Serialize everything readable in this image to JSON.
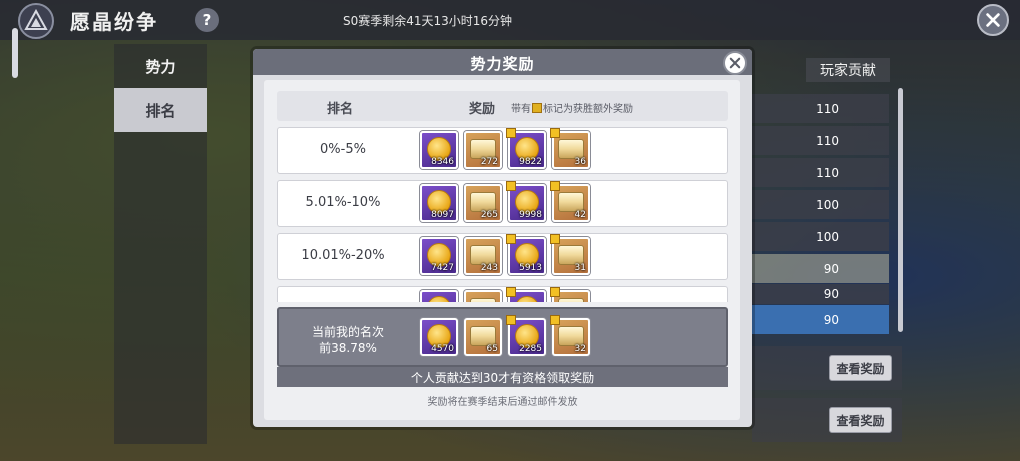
{
  "app": {
    "title": "愿晶纷争",
    "help_icon": "question-mark-icon",
    "season_remaining": "S0赛季剩余41天13小时16分钟",
    "close_icon": "close-icon"
  },
  "sidebar": {
    "tabs": [
      {
        "label": "势力"
      },
      {
        "label": "排名",
        "selected": true
      }
    ]
  },
  "background_list": {
    "header": "玩家贡献",
    "values": [
      "110",
      "110",
      "110",
      "100",
      "100",
      "90",
      "90",
      "90"
    ],
    "view_button_label": "查看奖励"
  },
  "dialog": {
    "title": "势力奖励",
    "col_rank": "排名",
    "col_reward": "奖励",
    "note_prefix": "带有",
    "note_suffix": "标记为获胜额外奖励",
    "rows": [
      {
        "label": "0%-5%",
        "items": [
          {
            "kind": "coin",
            "count": "8346"
          },
          {
            "kind": "chest",
            "count": "272"
          },
          {
            "kind": "coin",
            "count": "9822",
            "bonus": true
          },
          {
            "kind": "chest",
            "count": "36",
            "bonus": true
          }
        ]
      },
      {
        "label": "5.01%-10%",
        "items": [
          {
            "kind": "coin",
            "count": "8097"
          },
          {
            "kind": "chest",
            "count": "265"
          },
          {
            "kind": "coin",
            "count": "9998",
            "bonus": true
          },
          {
            "kind": "chest",
            "count": "42",
            "bonus": true
          }
        ]
      },
      {
        "label": "10.01%-20%",
        "items": [
          {
            "kind": "coin",
            "count": "7427"
          },
          {
            "kind": "chest",
            "count": "243"
          },
          {
            "kind": "coin",
            "count": "5913",
            "bonus": true
          },
          {
            "kind": "chest",
            "count": "31",
            "bonus": true
          }
        ]
      },
      {
        "label": "",
        "items": [
          {
            "kind": "coin",
            "count": ""
          },
          {
            "kind": "chest",
            "count": ""
          },
          {
            "kind": "coin",
            "count": "",
            "bonus": true
          },
          {
            "kind": "chest",
            "count": "",
            "bonus": true
          }
        ]
      }
    ],
    "mine": {
      "line1": "当前我的名次",
      "line2": "前38.78%",
      "items": [
        {
          "kind": "coin",
          "count": "4570"
        },
        {
          "kind": "chest",
          "count": "65"
        },
        {
          "kind": "coin",
          "count": "2285",
          "bonus": true
        },
        {
          "kind": "chest",
          "count": "32",
          "bonus": true
        }
      ]
    },
    "requirement_note": "个人贡献达到30才有资格领取奖励",
    "footer_note": "奖励将在赛季结束后通过邮件发放"
  }
}
